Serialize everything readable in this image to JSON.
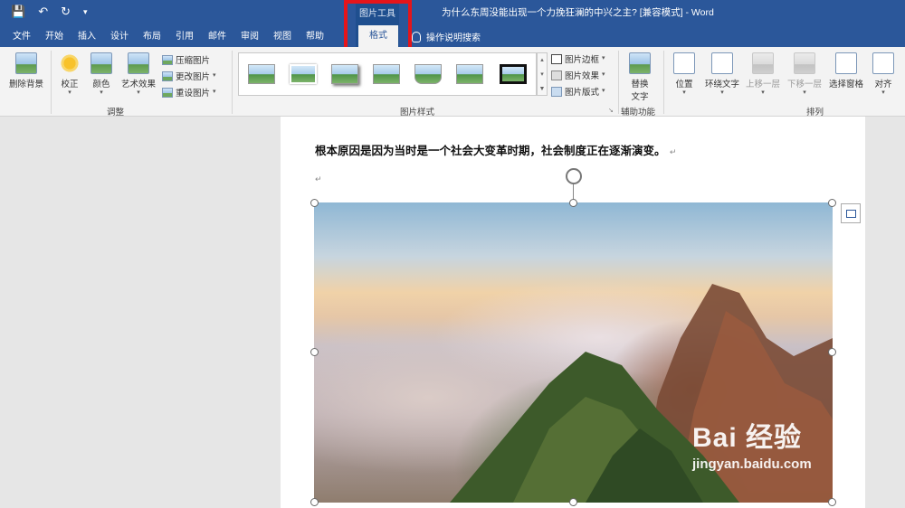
{
  "window": {
    "title": "为什么东周没能出现一个力挽狂澜的中兴之主? [兼容模式] - Word",
    "qat": [
      "save-icon",
      "undo-icon",
      "redo-icon",
      "customize-icon"
    ]
  },
  "tabs": {
    "items": [
      "文件",
      "开始",
      "插入",
      "设计",
      "布局",
      "引用",
      "邮件",
      "审阅",
      "视图",
      "帮助"
    ],
    "context_group": "图片工具",
    "active": "格式",
    "tell_me": "操作说明搜索"
  },
  "ribbon": {
    "adjust": {
      "remove_bg": "删除背景",
      "corrections": "校正",
      "color": "颜色",
      "artistic": "艺术效果",
      "compress": "压缩图片",
      "change": "更改图片",
      "reset": "重设图片",
      "label": "调整"
    },
    "styles": {
      "border": "图片边框",
      "effects": "图片效果",
      "layout": "图片版式",
      "label": "图片样式"
    },
    "accessibility": {
      "alt_text": "替换",
      "alt_text2": "文字",
      "label": "辅助功能"
    },
    "arrange": {
      "position": "位置",
      "wrap": "环绕文字",
      "forward": "上移一层",
      "backward": "下移一层",
      "pane": "选择窗格",
      "align": "对齐",
      "label": "排列"
    }
  },
  "document": {
    "paragraph": "根本原因是因为当时是一个社会大变革时期，社会制度正在逐渐演变。",
    "para_mark": "↵"
  },
  "watermark": {
    "main": "Bai 经验",
    "sub": "jingyan.baidu.com"
  },
  "colors": {
    "accent": "#2b579a",
    "highlight": "#e5151b"
  }
}
